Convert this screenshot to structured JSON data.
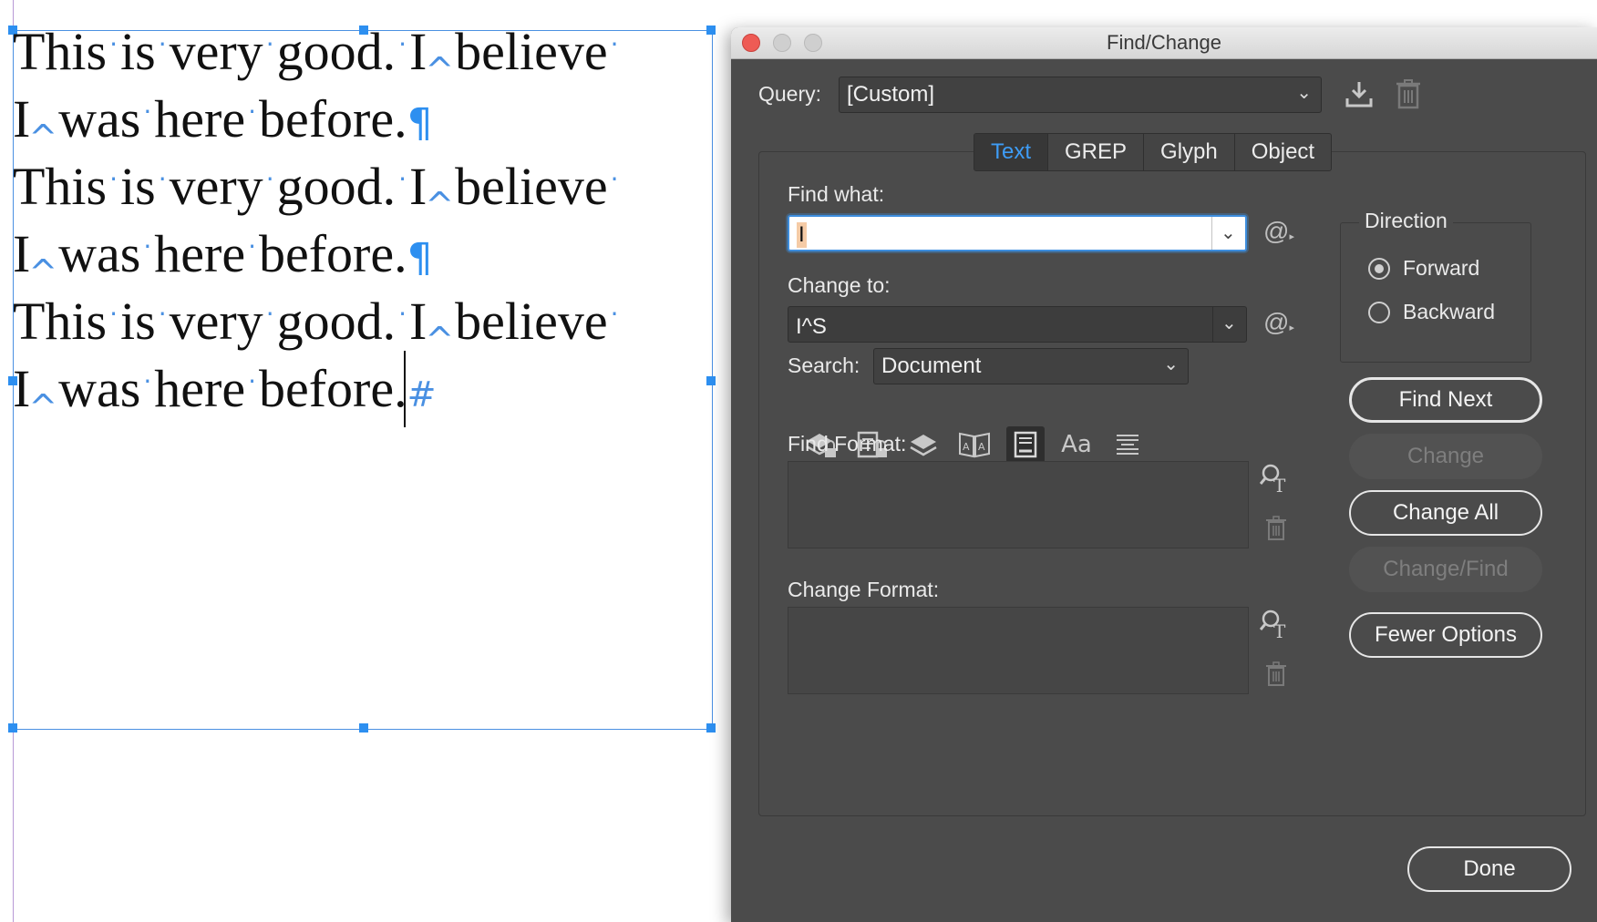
{
  "document": {
    "lines": [
      [
        "This",
        "is",
        "very",
        "good.",
        "I",
        "believe"
      ],
      [
        "I",
        "was",
        "here",
        "before."
      ],
      [
        "This",
        "is",
        "very",
        "good.",
        "I",
        "believe"
      ],
      [
        "I",
        "was",
        "here",
        "before."
      ],
      [
        "This",
        "is",
        "very",
        "good.",
        "I",
        "believe"
      ],
      [
        "I",
        "was",
        "here",
        "before."
      ]
    ],
    "pilcrow": "¶",
    "story_end": "#"
  },
  "dialog": {
    "title": "Find/Change",
    "query_label": "Query:",
    "query_value": "[Custom]",
    "tabs": [
      {
        "label": "Text",
        "active": true
      },
      {
        "label": "GREP",
        "active": false
      },
      {
        "label": "Glyph",
        "active": false
      },
      {
        "label": "Object",
        "active": false
      }
    ],
    "find_what_label": "Find what:",
    "find_what_value": "I",
    "change_to_label": "Change to:",
    "change_to_value": "I^S",
    "search_label": "Search:",
    "search_value": "Document",
    "find_format_label": "Find Format:",
    "change_format_label": "Change Format:",
    "direction": {
      "legend": "Direction",
      "forward": "Forward",
      "backward": "Backward",
      "selected": "Forward"
    },
    "buttons": {
      "find_next": "Find Next",
      "change": "Change",
      "change_all": "Change All",
      "change_find": "Change/Find",
      "fewer_options": "Fewer Options",
      "done": "Done"
    },
    "option_icons": [
      "include-locked-layers-icon",
      "include-locked-stories-icon",
      "include-hidden-layers-icon",
      "include-master-pages-icon",
      "include-footnotes-icon",
      "case-sensitive-icon",
      "whole-word-icon"
    ],
    "colors": {
      "accent": "#3e9cf5",
      "dialog_bg": "#4b4b4b",
      "selection_handle": "#2d8ff0"
    }
  }
}
